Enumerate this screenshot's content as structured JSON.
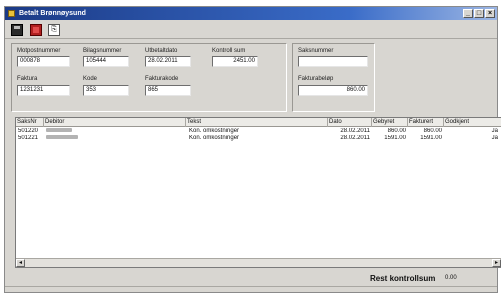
{
  "window": {
    "title": "Betalt Brønnøysund",
    "min_glyph": "_",
    "max_glyph": "□",
    "close_glyph": "×"
  },
  "toolbar": {
    "save_icon": "save-icon",
    "delete_icon": "delete-icon",
    "doc_icon": "document-icon",
    "doc_glyph": "⎘"
  },
  "form": {
    "motpostnummer": {
      "label": "Motpostnummer",
      "value": "000878"
    },
    "bilagsnummer": {
      "label": "Bilagsnummer",
      "value": "105444"
    },
    "utbetaltdato": {
      "label": "Utbetaltdato",
      "value": "28.02.2011"
    },
    "kontrollsum": {
      "label": "Kontroll sum",
      "value": "2451.00"
    },
    "faktura": {
      "label": "Faktura",
      "value": "1231231"
    },
    "kode": {
      "label": "Kode",
      "value": "353"
    },
    "fakturakode": {
      "label": "Fakturakode",
      "value": "865"
    },
    "saksnummer": {
      "label": "Saksnummer",
      "value": ""
    },
    "fakturabelop": {
      "label": "Fakturabeløp",
      "value": "860.00"
    }
  },
  "grid": {
    "columns": [
      "SaksNr",
      "Debitor",
      "Tekst",
      "Dato",
      "Gebyret",
      "Fakturert",
      "Godkjent"
    ],
    "rows": [
      {
        "saksnr": "501220",
        "tekst": "Kon. omkostninger",
        "dato": "28.02.2011",
        "gebyret": "860.00",
        "fakturert": "860.00",
        "godkjent": "Ja"
      },
      {
        "saksnr": "501221",
        "tekst": "Kon. omkostninger",
        "dato": "28.02.2011",
        "gebyret": "1591.00",
        "fakturert": "1591.00",
        "godkjent": "Ja"
      }
    ],
    "scroll_left": "◂",
    "scroll_right": "▸"
  },
  "footer": {
    "label": "Rest kontrollsum",
    "value": "0.00"
  }
}
